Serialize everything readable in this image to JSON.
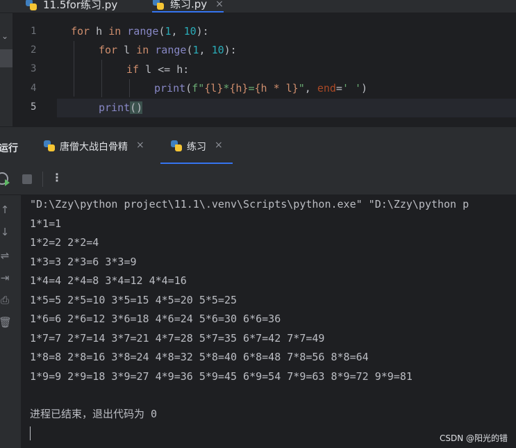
{
  "editor_tabs": [
    {
      "label": "11.5for练习.py",
      "active": false,
      "icon": "python-icon"
    },
    {
      "label": "练习.py",
      "active": true,
      "icon": "python-icon",
      "close": "×"
    }
  ],
  "gutter": {
    "line_numbers": [
      "1",
      "2",
      "3",
      "4",
      "5"
    ],
    "current_line": "5"
  },
  "code": {
    "line1": {
      "kw": "for",
      "var": " h ",
      "kw2": "in",
      "sp": " ",
      "fn": "range",
      "open": "(",
      "n1": "1",
      "comma": ", ",
      "n2": "10",
      "close": "):"
    },
    "line2": {
      "kw": "for",
      "var": " l ",
      "kw2": "in",
      "sp": " ",
      "fn": "range",
      "open": "(",
      "n1": "1",
      "comma": ", ",
      "n2": "10",
      "close": "):"
    },
    "line3": {
      "kw": "if",
      "rest": " l <= h:"
    },
    "line4": {
      "fn": "print",
      "open": "(",
      "fprefix": "f\"",
      "b1": "{l}",
      "s1": "*",
      "b2": "{h}",
      "s2": "=",
      "b3": "{h * l}",
      "s3": "\"",
      "comma": ", ",
      "param": "end",
      "eq": "=",
      "endval": "' '",
      "close": ")"
    },
    "line5": {
      "fn": "print",
      "parens": "()"
    }
  },
  "run_panel": {
    "title": "运行",
    "tabs": [
      {
        "label": "唐僧大战白骨精",
        "active": false,
        "close": "×"
      },
      {
        "label": "练习",
        "active": true,
        "close": "×"
      }
    ],
    "toolbar": {
      "rerun_icon": "rerun-icon",
      "stop_icon": "stop-icon",
      "more": "⋮"
    },
    "side_tools": [
      "↑",
      "↓",
      "⇌",
      "⇥",
      "⎙",
      "🗑"
    ]
  },
  "console": {
    "command": "\"D:\\Zzy\\python project\\11.1\\.venv\\Scripts\\python.exe\" \"D:\\Zzy\\python p",
    "lines": [
      "1*1=1",
      "1*2=2 2*2=4",
      "1*3=3 2*3=6 3*3=9",
      "1*4=4 2*4=8 3*4=12 4*4=16",
      "1*5=5 2*5=10 3*5=15 4*5=20 5*5=25",
      "1*6=6 2*6=12 3*6=18 4*6=24 5*6=30 6*6=36",
      "1*7=7 2*7=14 3*7=21 4*7=28 5*7=35 6*7=42 7*7=49",
      "1*8=8 2*8=16 3*8=24 4*8=32 5*8=40 6*8=48 7*8=56 8*8=64",
      "1*9=9 2*9=18 3*9=27 4*9=36 5*9=45 6*9=54 7*9=63 8*9=72 9*9=81"
    ],
    "exit_message": "进程已结束，退出代码为 0"
  },
  "watermark": "CSDN @阳光的错"
}
